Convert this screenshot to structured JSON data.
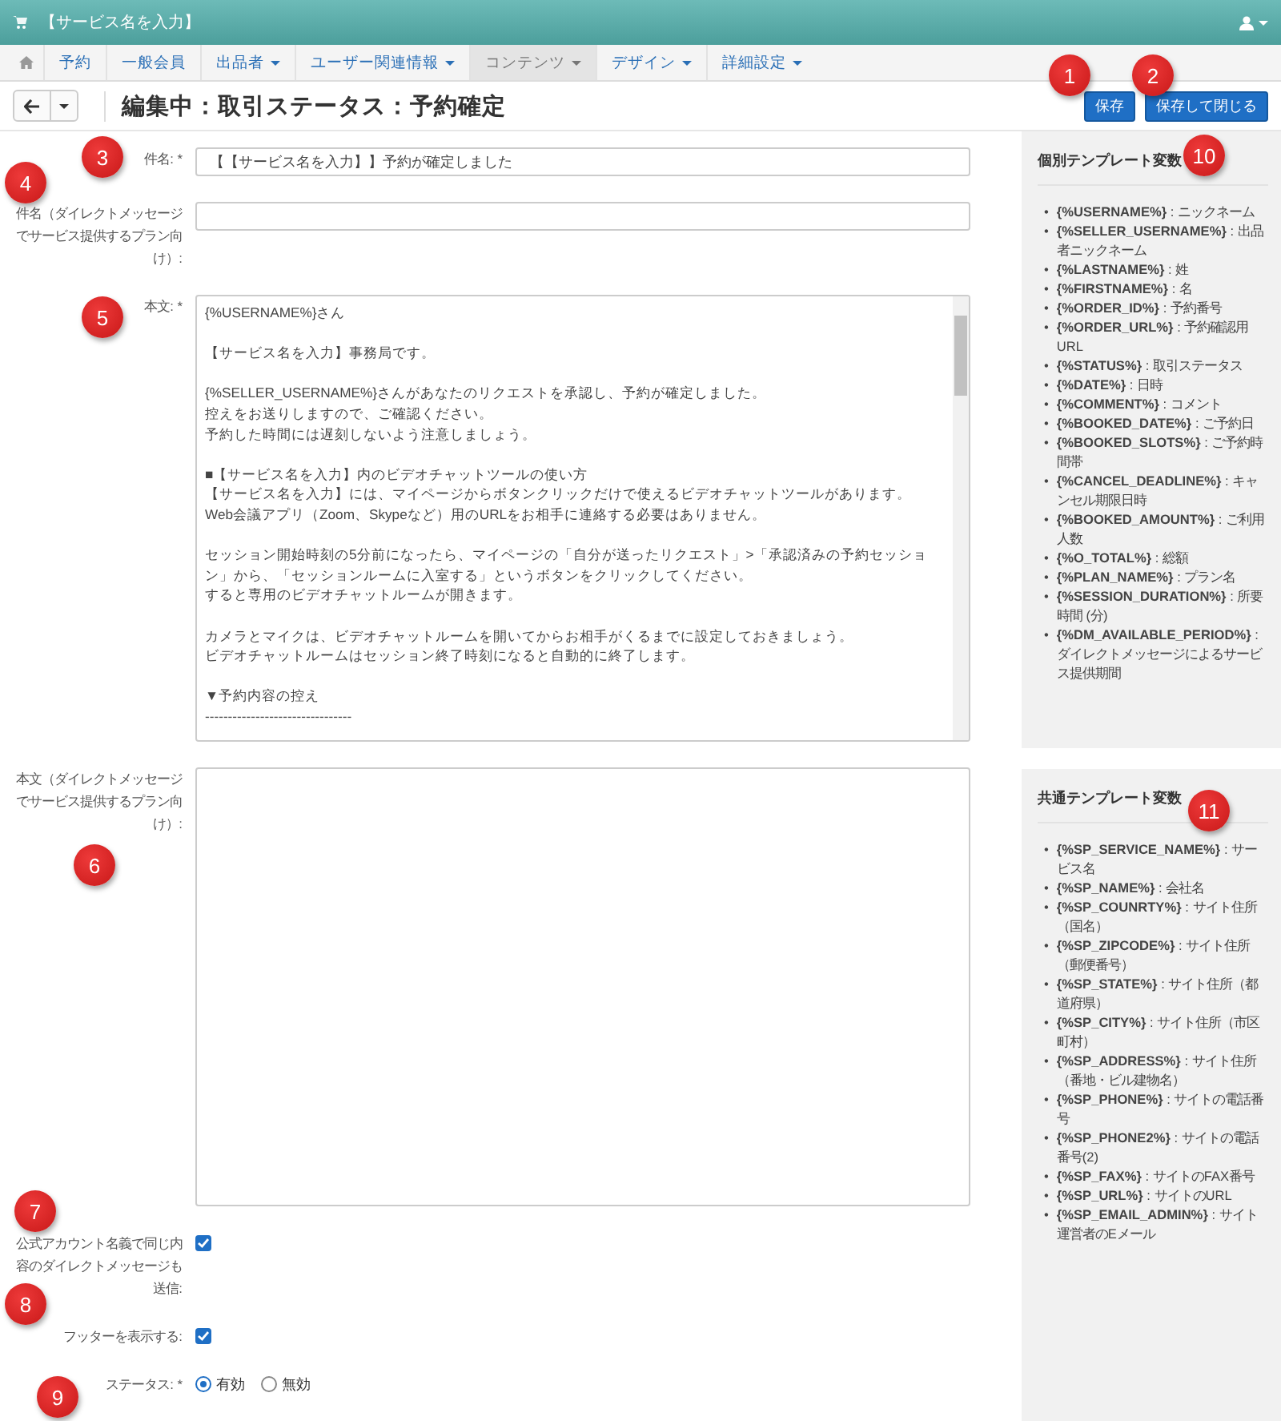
{
  "topbar": {
    "site_name": "【サービス名を入力】"
  },
  "nav": {
    "items": [
      {
        "label": "予約",
        "has_menu": false,
        "selected": false
      },
      {
        "label": "一般会員",
        "has_menu": false,
        "selected": false
      },
      {
        "label": "出品者",
        "has_menu": true,
        "selected": false
      },
      {
        "label": "ユーザー関連情報",
        "has_menu": true,
        "selected": false
      },
      {
        "label": "コンテンツ",
        "has_menu": true,
        "selected": true
      },
      {
        "label": "デザイン",
        "has_menu": true,
        "selected": false
      },
      {
        "label": "詳細設定",
        "has_menu": true,
        "selected": false
      }
    ]
  },
  "toolbar": {
    "title": "編集中：取引ステータス：予約確定",
    "buttons": [
      "保存",
      "保存して閉じる"
    ]
  },
  "form": {
    "fields": [
      {
        "kind": "text",
        "label": "件名: *",
        "value": "【【サービス名を入力】】予約が確定しました"
      },
      {
        "kind": "text",
        "label": "件名（ダイレクトメッセージでサービス提供するプラン向け）:"
      },
      {
        "kind": "textarea",
        "label": "本文: *",
        "paragraphs": [
          [
            "{%USERNAME%}さん"
          ],
          [
            "【サービス名を入力】事務局です。"
          ],
          [
            "{%SELLER_USERNAME%}さんがあなたのリクエストを承認し、予約が確定しました。",
            "控えをお送りしますので、ご確認ください。",
            "予約した時間には遅刻しないよう注意しましょう。"
          ],
          [
            "■【サービス名を入力】内のビデオチャットツールの使い方",
            "【サービス名を入力】には、マイページからボタンクリックだけで使えるビデオチャットツールがあります。",
            "Web会議アプリ（Zoom、Skypeなど）用のURLをお相手に連絡する必要はありません。"
          ],
          [
            "セッション開始時刻の5分前になったら、マイページの「自分が送ったリクエスト」>「承認済みの予約セッション」から、「セッションルームに入室する」というボタンをクリックしてください。",
            "すると専用のビデオチャットルームが開きます。"
          ],
          [
            "カメラとマイクは、ビデオチャットルームを開いてからお相手がくるまでに設定しておきましょう。",
            "ビデオチャットルームはセッション終了時刻になると自動的に終了します。"
          ],
          [
            "▼予約内容の控え",
            "--------------------------------"
          ]
        ]
      },
      {
        "kind": "textarea",
        "label": "本文（ダイレクトメッセージでサービス提供するプラン向け）:"
      },
      {
        "kind": "checkbox",
        "label": "公式アカウント名義で同じ内容のダイレクトメッセージも送信:",
        "checked": true
      },
      {
        "kind": "checkbox",
        "label": "フッターを表示する:",
        "checked": true
      },
      {
        "kind": "radio",
        "label": "ステータス: *",
        "options": [
          {
            "label": "有効",
            "selected": true
          },
          {
            "label": "無効",
            "selected": false
          }
        ]
      }
    ]
  },
  "sidebar": {
    "sections": [
      {
        "title": "個別テンプレート変数",
        "items": [
          {
            "bullet": "•",
            "var": "{%USERNAME%}",
            "desc": ": ニックネーム"
          },
          {
            "bullet": "•",
            "var": "{%SELLER_USERNAME%}",
            "desc": ": 出品者ニックネーム"
          },
          {
            "bullet": "•",
            "var": "{%LASTNAME%}",
            "desc": ": 姓"
          },
          {
            "bullet": "•",
            "var": "{%FIRSTNAME%}",
            "desc": ": 名"
          },
          {
            "bullet": "•",
            "var": "{%ORDER_ID%}",
            "desc": ": 予約番号"
          },
          {
            "bullet": "•",
            "var": "{%ORDER_URL%}",
            "desc": ": 予約確認用URL"
          },
          {
            "bullet": "•",
            "var": "{%STATUS%}",
            "desc": ": 取引ステータス"
          },
          {
            "bullet": "•",
            "var": "{%DATE%}",
            "desc": ": 日時"
          },
          {
            "bullet": "•",
            "var": "{%COMMENT%}",
            "desc": ": コメント"
          },
          {
            "bullet": "•",
            "var": "{%BOOKED_DATE%}",
            "desc": ": ご予約日"
          },
          {
            "bullet": "•",
            "var": "{%BOOKED_SLOTS%}",
            "desc": ": ご予約時間帯"
          },
          {
            "bullet": "•",
            "var": "{%CANCEL_DEADLINE%}",
            "desc": ": キャンセル期限日時"
          },
          {
            "bullet": "•",
            "var": "{%BOOKED_AMOUNT%}",
            "desc": ": ご利用人数"
          },
          {
            "bullet": "•",
            "var": "{%O_TOTAL%}",
            "desc": ": 総額"
          },
          {
            "bullet": "•",
            "var": "{%PLAN_NAME%}",
            "desc": ": プラン名"
          },
          {
            "bullet": "•",
            "var": "{%SESSION_DURATION%}",
            "desc": ": 所要時間 (分)"
          },
          {
            "bullet": "•",
            "var": "{%DM_AVAILABLE_PERIOD%}",
            "desc": ": ダイレクトメッセージによるサービス提供期間"
          }
        ]
      },
      {
        "title": "共通テンプレート変数",
        "items": [
          {
            "bullet": "•",
            "var": "{%SP_SERVICE_NAME%}",
            "desc": ": サービス名"
          },
          {
            "bullet": "•",
            "var": "{%SP_NAME%}",
            "desc": ": 会社名"
          },
          {
            "bullet": "•",
            "var": "{%SP_COUNRTY%}",
            "desc": ": サイト住所（国名）"
          },
          {
            "bullet": "•",
            "var": "{%SP_ZIPCODE%}",
            "desc": ": サイト住所（郵便番号）"
          },
          {
            "bullet": "•",
            "var": "{%SP_STATE%}",
            "desc": ": サイト住所（都道府県）"
          },
          {
            "bullet": "•",
            "var": "{%SP_CITY%}",
            "desc": ": サイト住所（市区町村）"
          },
          {
            "bullet": "•",
            "var": "{%SP_ADDRESS%}",
            "desc": ": サイト住所（番地・ビル建物名）"
          },
          {
            "bullet": "•",
            "var": "{%SP_PHONE%}",
            "desc": ": サイトの電話番号"
          },
          {
            "bullet": "•",
            "var": "{%SP_PHONE2%}",
            "desc": ": サイトの電話番号(2)"
          },
          {
            "bullet": "•",
            "var": "{%SP_FAX%}",
            "desc": ": サイトのFAX番号"
          },
          {
            "bullet": "•",
            "var": "{%SP_URL%}",
            "desc": ": サイトのURL"
          },
          {
            "bullet": "•",
            "var": "{%SP_EMAIL_ADMIN%}",
            "desc": ": サイト運営者のEメール"
          }
        ]
      }
    ]
  },
  "callouts": [
    "1",
    "2",
    "3",
    "4",
    "5",
    "6",
    "7",
    "8",
    "9",
    "10",
    "11"
  ]
}
